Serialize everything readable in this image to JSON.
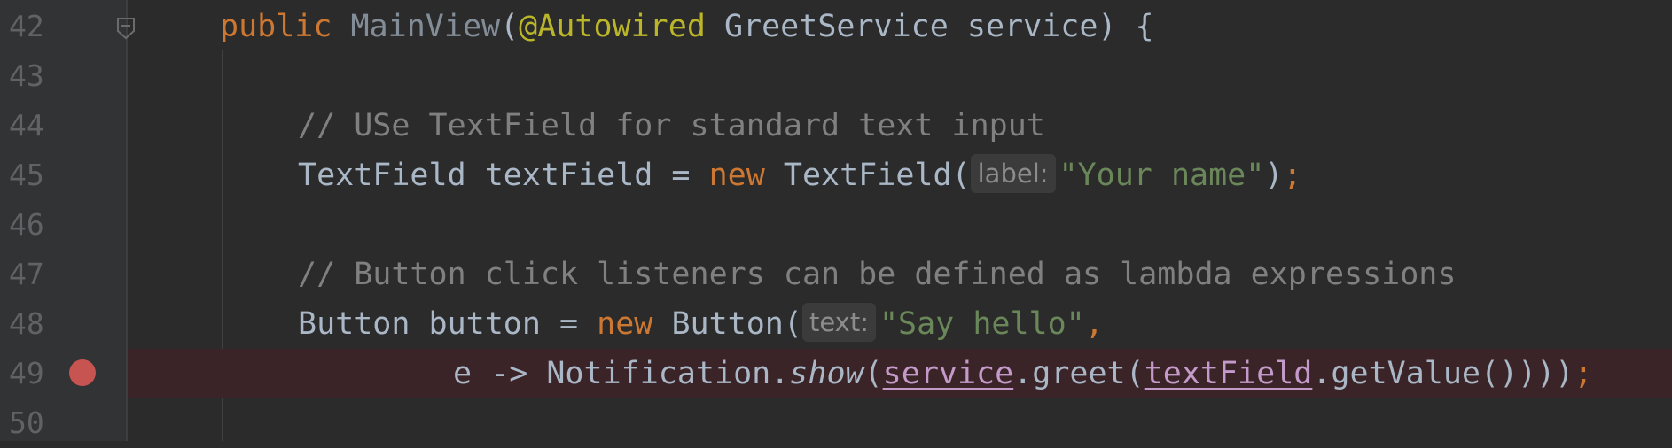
{
  "editor": {
    "lines": [
      {
        "num": "42",
        "parts": [
          {
            "t": "public",
            "c": "kw"
          },
          {
            "t": " ",
            "c": ""
          },
          {
            "t": "MainView",
            "c": "dim"
          },
          {
            "t": "(",
            "c": ""
          },
          {
            "t": "@Autowired",
            "c": "ann"
          },
          {
            "t": " GreetService service) {",
            "c": ""
          }
        ]
      },
      {
        "num": "43",
        "parts": []
      },
      {
        "num": "44",
        "parts": [
          {
            "t": "// USe TextField for standard text input",
            "c": "cmt"
          }
        ]
      },
      {
        "num": "45",
        "parts": [
          {
            "t": "TextField textField = ",
            "c": ""
          },
          {
            "t": "new",
            "c": "kw"
          },
          {
            "t": " TextField(",
            "c": ""
          },
          {
            "t": "label:",
            "c": "hint"
          },
          {
            "t": "\"Your name\"",
            "c": "str"
          },
          {
            "t": ")",
            "c": ""
          },
          {
            "t": ";",
            "c": "kw"
          }
        ]
      },
      {
        "num": "46",
        "parts": []
      },
      {
        "num": "47",
        "parts": [
          {
            "t": "// Button click listeners can be defined as lambda expressions",
            "c": "cmt"
          }
        ]
      },
      {
        "num": "48",
        "parts": [
          {
            "t": "Button button = ",
            "c": ""
          },
          {
            "t": "new",
            "c": "kw"
          },
          {
            "t": " Button(",
            "c": ""
          },
          {
            "t": "text:",
            "c": "hint"
          },
          {
            "t": "\"Say hello\"",
            "c": "str"
          },
          {
            "t": ",",
            "c": "kw"
          }
        ]
      },
      {
        "num": "49",
        "parts": [
          {
            "t": "e -> Notification.",
            "c": ""
          },
          {
            "t": "show",
            "c": "it"
          },
          {
            "t": "(",
            "c": ""
          },
          {
            "t": "service",
            "c": "field"
          },
          {
            "t": ".greet(",
            "c": ""
          },
          {
            "t": "textField",
            "c": "field"
          },
          {
            "t": ".getValue()))",
            "c": ""
          },
          {
            "t": ")",
            "c": ""
          },
          {
            "t": ";",
            "c": "kw"
          }
        ]
      },
      {
        "num": "50",
        "parts": []
      }
    ]
  }
}
